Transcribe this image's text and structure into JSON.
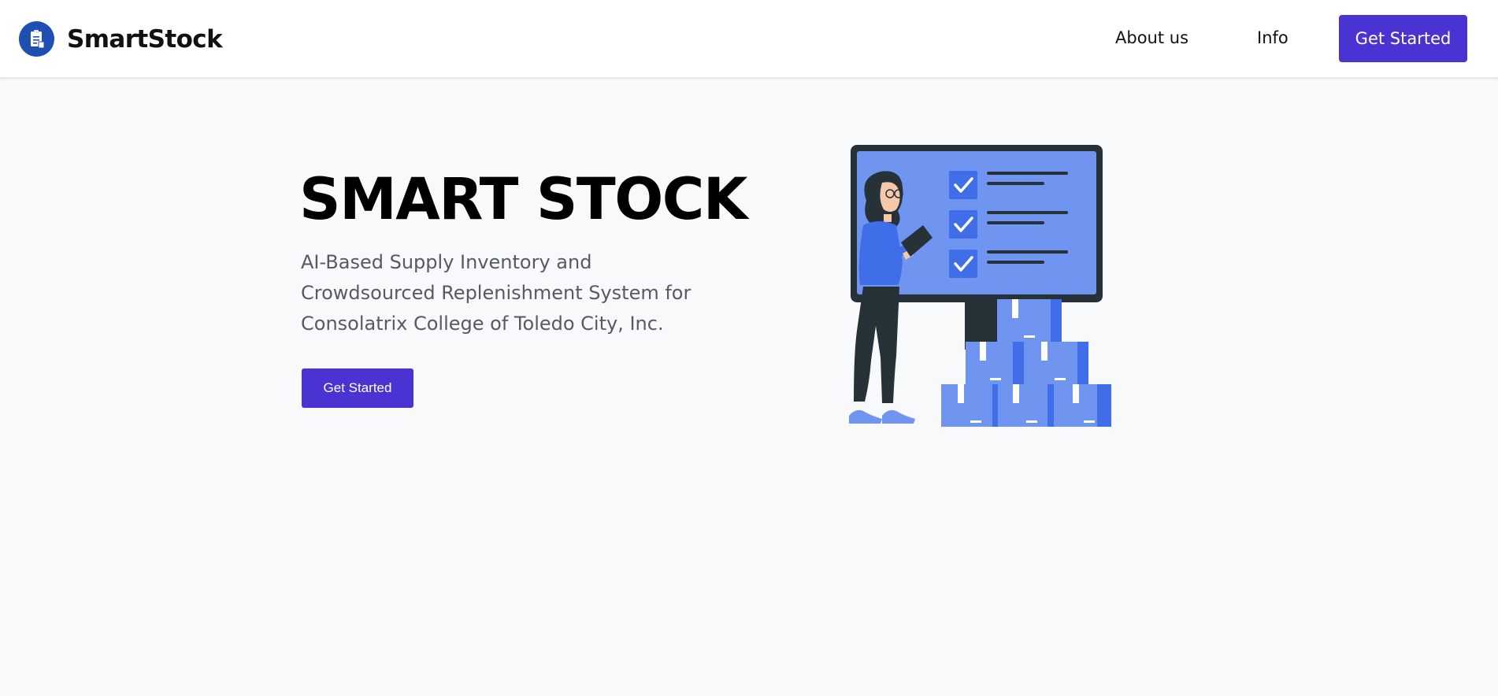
{
  "brand": {
    "name": "SmartStock",
    "logo_icon": "clipboard-icon",
    "logo_color": "#1f4fb3"
  },
  "nav": {
    "links": [
      {
        "label": "About us"
      },
      {
        "label": "Info"
      }
    ],
    "cta_label": "Get Started"
  },
  "hero": {
    "title": "SMART STOCK",
    "subtitle": "AI-Based Supply Inventory and Crowdsourced Replenishment System for Consolatrix College of Toledo City, Inc.",
    "cta_label": "Get Started",
    "illustration_icon": "inventory-checklist-illustration"
  },
  "colors": {
    "accent": "#4a33d3",
    "background": "#f8f9fb",
    "illustration_blue": "#6f95f0",
    "illustration_dark": "#263238"
  }
}
